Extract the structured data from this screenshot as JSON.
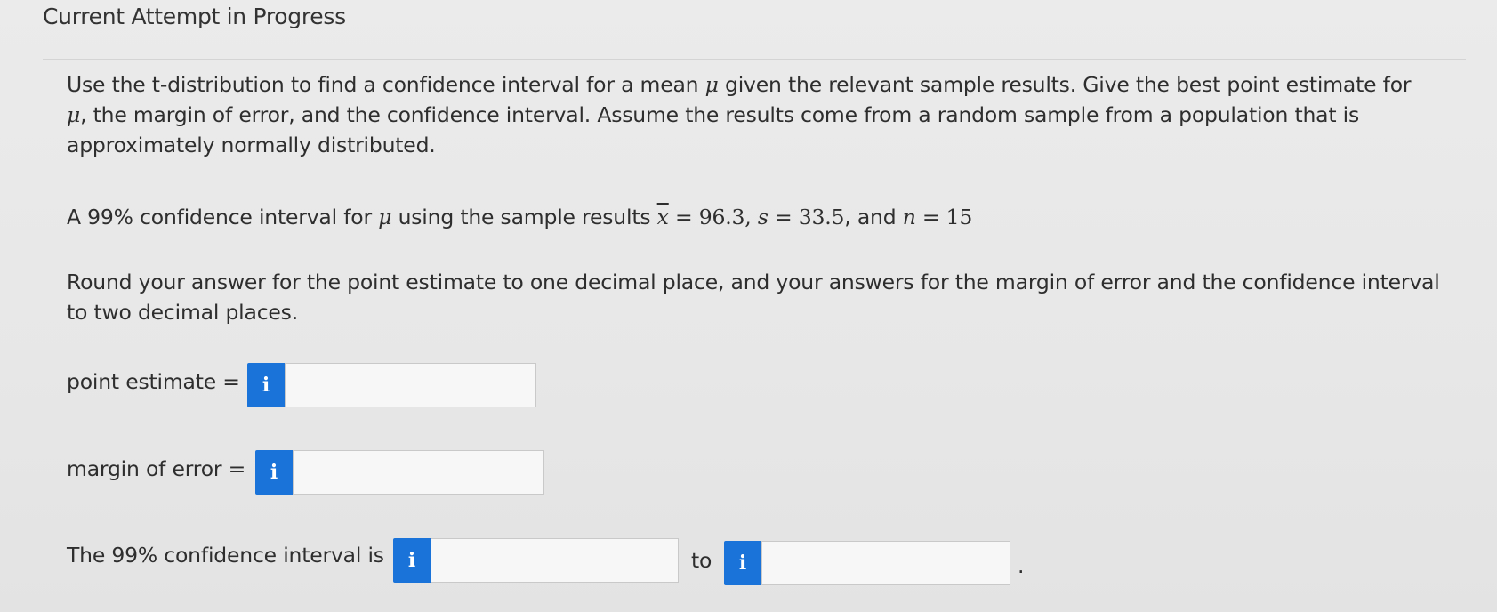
{
  "header": {
    "title": "Current Attempt in Progress"
  },
  "question": {
    "intro_part1": "Use the t-distribution to find a confidence interval for a mean ",
    "mu": "μ",
    "intro_part2": " given the relevant sample results. Give the best point estimate for ",
    "intro_part3": ", the margin of error, and the confidence interval. Assume the results come from a random sample from a population that is approximately normally distributed.",
    "problem_prefix": "A 99% confidence interval for ",
    "problem_mid": " using the sample results ",
    "xbar": "x",
    "eq": " = ",
    "xbar_value": "96.3",
    "s_sym": "s",
    "s_value": "33.5",
    "and_text": ", and ",
    "n_sym": "n",
    "n_value": "15",
    "comma": ", ",
    "rounding": "Round your answer for the point estimate to one decimal place, and your answers for the margin of error and the confidence interval to two decimal places."
  },
  "answers": {
    "point_estimate_label": "point estimate =",
    "point_estimate_value": "",
    "margin_label": "margin of error =",
    "margin_value": "",
    "interval_label": "The 99% confidence interval is",
    "interval_lower": "",
    "to_label": "to",
    "interval_upper": "",
    "period": ".",
    "info_icon": "i"
  },
  "colors": {
    "info_button": "#1a73d9",
    "background": "#e9e9e9"
  }
}
